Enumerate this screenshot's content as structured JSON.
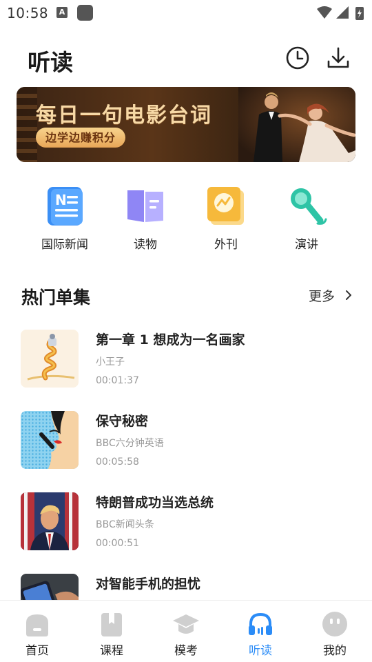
{
  "status_bar": {
    "time": "10:58"
  },
  "header": {
    "title": "听读",
    "history_icon": "history-icon",
    "download_icon": "download-icon"
  },
  "banner": {
    "title": "每日一句电影台词",
    "pill": "边学边赚积分"
  },
  "categories": [
    {
      "label": "国际新闻",
      "icon": "news-icon",
      "color": "#3b8ff5"
    },
    {
      "label": "读物",
      "icon": "book-icon",
      "color": "#8f86f5"
    },
    {
      "label": "外刊",
      "icon": "magazine-icon",
      "color": "#f6b93b"
    },
    {
      "label": "演讲",
      "icon": "microphone-icon",
      "color": "#2ec4a6"
    }
  ],
  "section": {
    "title": "热门单集",
    "more": "更多"
  },
  "episodes": [
    {
      "title": "第一章 1 想成为一名画家",
      "source": "小王子",
      "duration": "00:01:37",
      "thumb": "snake-drawing"
    },
    {
      "title": "保守秘密",
      "source": "BBC六分钟英语",
      "duration": "00:05:58",
      "thumb": "pop-art-secret"
    },
    {
      "title": "特朗普成功当选总统",
      "source": "BBC新闻头条",
      "duration": "00:00:51",
      "thumb": "trump-photo"
    },
    {
      "title": "对智能手机的担忧",
      "source": "",
      "duration": "",
      "thumb": "smartphone-photo"
    }
  ],
  "nav": [
    {
      "label": "首页",
      "icon": "home-icon"
    },
    {
      "label": "课程",
      "icon": "course-book-icon"
    },
    {
      "label": "模考",
      "icon": "graduation-cap-icon"
    },
    {
      "label": "听读",
      "icon": "headphones-icon",
      "active": true
    },
    {
      "label": "我的",
      "icon": "profile-face-icon"
    }
  ],
  "colors": {
    "accent": "#2b8cf7",
    "inactive_icon": "#cfcfcf"
  }
}
